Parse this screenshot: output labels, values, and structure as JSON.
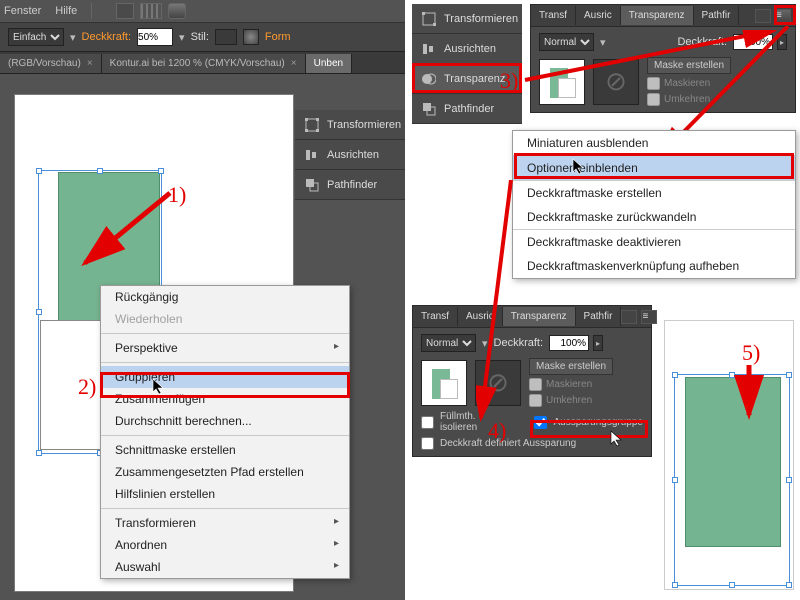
{
  "menubar": {
    "window": "Fenster",
    "help": "Hilfe"
  },
  "controlbar": {
    "style_lbl": "Einfach",
    "opacity_lbl": "Deckkraft:",
    "opacity_val": "50%",
    "stil_lbl": "Stil:",
    "form_lbl": "Form"
  },
  "tabs": {
    "tab1": "(RGB/Vorschau)",
    "tab2": "Kontur.ai bei 1200 % (CMYK/Vorschau)",
    "tab3": "Unben"
  },
  "side_panels": {
    "transform": "Transformieren",
    "align": "Ausrichten",
    "transparency": "Transparenz",
    "pathfinder": "Pathfinder"
  },
  "context_menu": {
    "undo": "Rückgängig",
    "redo": "Wiederholen",
    "perspective": "Perspektive",
    "group": "Gruppieren",
    "join": "Zusammenfügen",
    "average": "Durchschnitt berechnen...",
    "clip": "Schnittmaske erstellen",
    "compound": "Zusammengesetzten Pfad erstellen",
    "guides": "Hilfslinien erstellen",
    "transform": "Transformieren",
    "arrange": "Anordnen",
    "select": "Auswahl"
  },
  "transparency_panel": {
    "tab_transf": "Transf",
    "tab_ausric": "Ausric",
    "tab_trans": "Transparenz",
    "tab_pathf": "Pathfir",
    "blend_mode": "Normal",
    "opacity_lbl": "Deckkraft:",
    "opacity_val": "100%",
    "make_mask": "Maske erstellen",
    "clip_chk": "Maskieren",
    "invert_chk": "Umkehren",
    "isolate_lbl": "Füllmth. isolieren",
    "knockout_lbl": "Aussparungsgruppe",
    "opacity_shape_lbl": "Deckkraft definiert Aussparung"
  },
  "flyout": {
    "hide_thumbs": "Miniaturen ausblenden",
    "show_options": "Optionen einblenden",
    "make_mask": "Deckkraftmaske erstellen",
    "release_mask": "Deckkraftmaske zurückwandeln",
    "disable_mask": "Deckkraftmaske deaktivieren",
    "unlink_mask": "Deckkraftmaskenverknüpfung aufheben"
  },
  "annotations": {
    "a1": "1)",
    "a2": "2)",
    "a3": "3)",
    "a4": "4)",
    "a5": "5)"
  }
}
